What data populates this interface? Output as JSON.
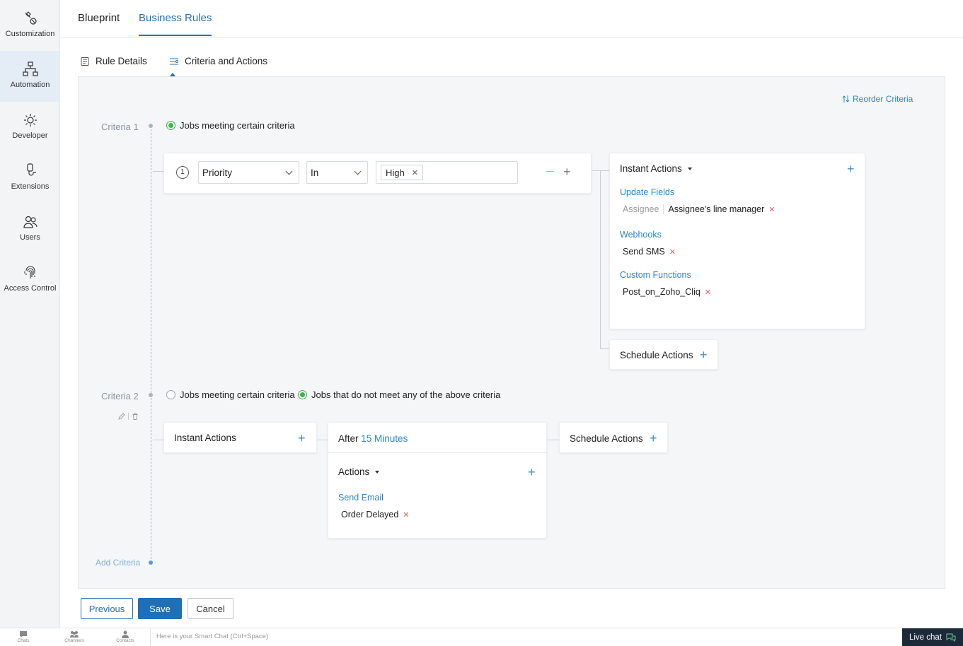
{
  "sidebar": {
    "items": [
      {
        "label": "Customization",
        "icon": "customization-icon"
      },
      {
        "label": "Automation",
        "icon": "automation-icon"
      },
      {
        "label": "Developer",
        "icon": "developer-icon"
      },
      {
        "label": "Extensions",
        "icon": "extensions-icon"
      },
      {
        "label": "Users",
        "icon": "users-icon"
      },
      {
        "label": "Access Control",
        "icon": "fingerprint-icon"
      }
    ],
    "active_index": 1
  },
  "top_tabs": [
    "Blueprint",
    "Business Rules"
  ],
  "sub_tabs": [
    "Rule Details",
    "Criteria and Actions"
  ],
  "reorder_label": "Reorder Criteria",
  "criteria1": {
    "label": "Criteria 1",
    "radio_label": "Jobs meeting certain criteria",
    "condition": {
      "number": "1",
      "field": "Priority",
      "operator": "In",
      "value_tag": "High"
    },
    "instant_actions": {
      "title": "Instant Actions",
      "groups": [
        {
          "heading": "Update Fields",
          "field": "Assignee",
          "value": "Assignee's line manager"
        },
        {
          "heading": "Webhooks",
          "value": "Send SMS"
        },
        {
          "heading": "Custom Functions",
          "value": "Post_on_Zoho_Cliq"
        }
      ]
    },
    "schedule_actions": "Schedule Actions"
  },
  "criteria2": {
    "label": "Criteria 2",
    "radio_option1": "Jobs meeting certain criteria",
    "radio_option2": "Jobs that do not meet any of the above criteria",
    "instant_actions": "Instant Actions",
    "after_prefix": "After",
    "after_value": "15 Minutes",
    "actions_title": "Actions",
    "send_email_heading": "Send Email",
    "send_email_value": "Order Delayed",
    "schedule_actions": "Schedule Actions"
  },
  "add_criteria": "Add Criteria",
  "buttons": {
    "previous": "Previous",
    "save": "Save",
    "cancel": "Cancel"
  },
  "bottom_bar": {
    "items": [
      "Chats",
      "Channels",
      "Contacts"
    ],
    "smart_chat_placeholder": "Here is your Smart Chat (Ctrl+Space)",
    "live_chat": "Live chat"
  },
  "colors": {
    "accent": "#2a6fb5",
    "link": "#2a85d4",
    "radio_on": "#3ab54a",
    "remove": "#e06060"
  }
}
